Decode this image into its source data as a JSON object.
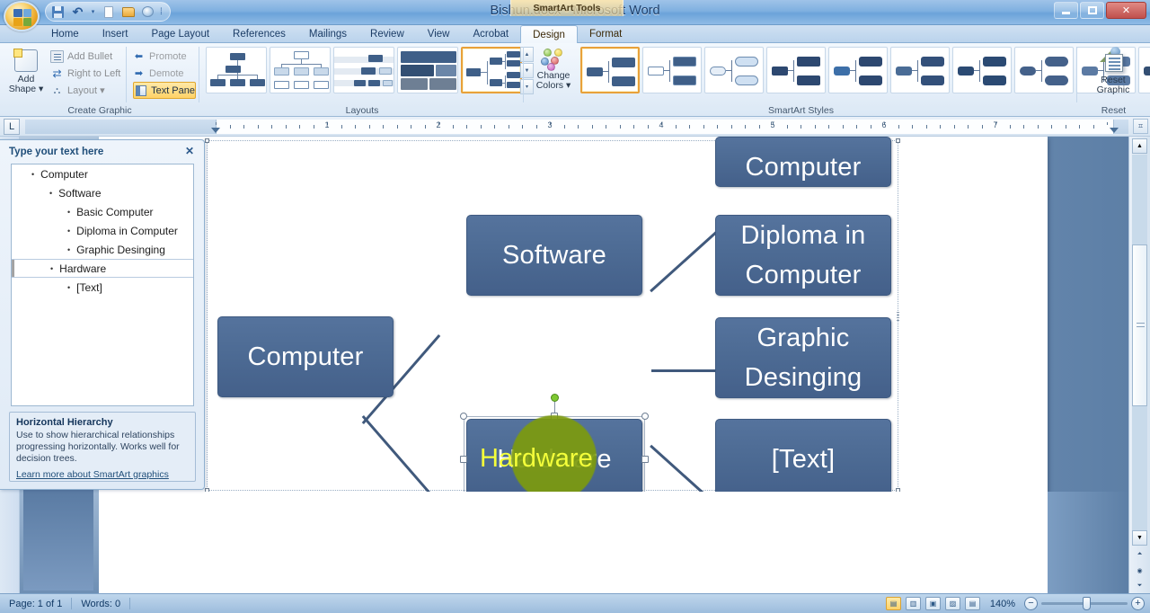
{
  "window": {
    "title": "Bishun.docx - Microsoft Word",
    "context_tab_group": "SmartArt Tools",
    "minimize": "–",
    "maximize": "▫",
    "close": "✕"
  },
  "quick_access": {
    "items": [
      {
        "name": "office-orb",
        "label": "Office"
      },
      {
        "name": "save-icon",
        "label": "Save"
      },
      {
        "name": "undo-icon",
        "label": "Undo"
      },
      {
        "name": "undo-dropdown-icon",
        "label": "▾"
      },
      {
        "name": "new-document-icon",
        "label": "New"
      },
      {
        "name": "open-icon",
        "label": "Open"
      },
      {
        "name": "print-preview-icon",
        "label": "Print Preview"
      },
      {
        "name": "qat-more-icon",
        "label": "⁞"
      }
    ]
  },
  "ribbon": {
    "tabs": [
      {
        "label": "Home",
        "active": false,
        "contextual": false
      },
      {
        "label": "Insert",
        "active": false,
        "contextual": false
      },
      {
        "label": "Page Layout",
        "active": false,
        "contextual": false
      },
      {
        "label": "References",
        "active": false,
        "contextual": false
      },
      {
        "label": "Mailings",
        "active": false,
        "contextual": false
      },
      {
        "label": "Review",
        "active": false,
        "contextual": false
      },
      {
        "label": "View",
        "active": false,
        "contextual": false
      },
      {
        "label": "Acrobat",
        "active": false,
        "contextual": false
      },
      {
        "label": "Design",
        "active": true,
        "contextual": true
      },
      {
        "label": "Format",
        "active": false,
        "contextual": true
      }
    ],
    "groups": {
      "create_graphic": {
        "label": "Create Graphic",
        "add_shape": {
          "line1": "Add",
          "line2": "Shape",
          "caret": "▾"
        },
        "commands": [
          {
            "label": "Add Bullet",
            "icon": "bullet-icon",
            "enabled": false
          },
          {
            "label": "Right to Left",
            "icon": "right-to-left-icon",
            "enabled": false
          },
          {
            "label": "Layout",
            "icon": "layout-icon",
            "caret": "▾",
            "enabled": false
          }
        ],
        "side_commands": [
          {
            "label": "Promote",
            "icon": "promote-arrow-icon",
            "active": false
          },
          {
            "label": "Demote",
            "icon": "demote-arrow-icon",
            "active": false
          },
          {
            "label": "Text Pane",
            "icon": "text-pane-icon",
            "active": true
          }
        ]
      },
      "layouts": {
        "label": "Layouts",
        "items": [
          {
            "name": "layout-organization-chart",
            "selected": false
          },
          {
            "name": "layout-hierarchy",
            "selected": false
          },
          {
            "name": "layout-labeled-hierarchy",
            "selected": false
          },
          {
            "name": "layout-table-hierarchy",
            "selected": false
          },
          {
            "name": "layout-horizontal-hierarchy",
            "selected": true
          }
        ],
        "scroll_up": "▲",
        "scroll_down": "▼",
        "more": "▾"
      },
      "smartart_styles": {
        "label": "SmartArt Styles",
        "change_colors": {
          "line1": "Change",
          "line2": "Colors",
          "caret": "▾"
        },
        "items": [
          {
            "name": "style-simple-fill",
            "selected": true
          },
          {
            "name": "style-white-outline",
            "selected": false
          },
          {
            "name": "style-subtle-effect",
            "selected": false
          },
          {
            "name": "style-moderate-effect",
            "selected": false
          },
          {
            "name": "style-intense-effect",
            "selected": false
          },
          {
            "name": "style-polished",
            "selected": false
          },
          {
            "name": "style-inset",
            "selected": false
          },
          {
            "name": "style-cartoon",
            "selected": false
          },
          {
            "name": "style-powder",
            "selected": false
          },
          {
            "name": "style-brick-scene",
            "selected": false
          }
        ]
      },
      "reset": {
        "label": "Reset",
        "reset_graphic": {
          "line1": "Reset",
          "line2": "Graphic"
        }
      }
    }
  },
  "ruler": {
    "tab_selector": "L",
    "numbers": [
      "1",
      "2",
      "3",
      "4",
      "5",
      "6",
      "7"
    ]
  },
  "text_pane": {
    "title": "Type your text here",
    "close": "✕",
    "bullet": "•",
    "items": [
      {
        "label": "Computer",
        "level": 1,
        "selected": false
      },
      {
        "label": "Software",
        "level": 2,
        "selected": false
      },
      {
        "label": "Basic Computer",
        "level": 3,
        "selected": false
      },
      {
        "label": "Diploma in Computer",
        "level": 3,
        "selected": false
      },
      {
        "label": "Graphic Desinging",
        "level": 3,
        "selected": false
      },
      {
        "label": "Hardware",
        "level": 2,
        "selected": true
      },
      {
        "label": "[Text]",
        "level": 3,
        "selected": false
      }
    ],
    "help": {
      "title": "Horizontal Hierarchy",
      "description": "Use to show hierarchical relationships progressing horizontally. Works well for decision trees.",
      "link": "Learn more about SmartArt graphics"
    }
  },
  "smartart": {
    "nodes": [
      {
        "id": "root",
        "label": "Computer",
        "selected": false
      },
      {
        "id": "software",
        "label": "Software",
        "selected": false
      },
      {
        "id": "hardware",
        "label": "Hardware",
        "selected": true
      },
      {
        "id": "basic",
        "label": "Computer",
        "selected": false
      },
      {
        "id": "diploma",
        "label": "Diploma in Computer",
        "selected": false
      },
      {
        "id": "graphic",
        "label": "Graphic Desinging",
        "selected": false
      },
      {
        "id": "placeholder",
        "label": "[Text]",
        "selected": false
      }
    ],
    "node_fill": "#4d6b94",
    "connector_color": "#40597c",
    "cursor_highlight_color": "#7d9b0e",
    "cursor_text_color": "#f4ff3a",
    "rotation_handle_color": "#7ec832"
  },
  "status_bar": {
    "page": "Page: 1 of 1",
    "words": "Words: 0",
    "proofing_icon": "spell-check-icon",
    "views": [
      {
        "name": "print-layout-view",
        "glyph": "▤",
        "active": true
      },
      {
        "name": "full-screen-reading-view",
        "glyph": "▥",
        "active": false
      },
      {
        "name": "web-layout-view",
        "glyph": "▣",
        "active": false
      },
      {
        "name": "outline-view",
        "glyph": "▨",
        "active": false
      },
      {
        "name": "draft-view",
        "glyph": "▤",
        "active": false
      }
    ],
    "zoom": "140%",
    "zoom_out": "−",
    "zoom_in": "+"
  }
}
